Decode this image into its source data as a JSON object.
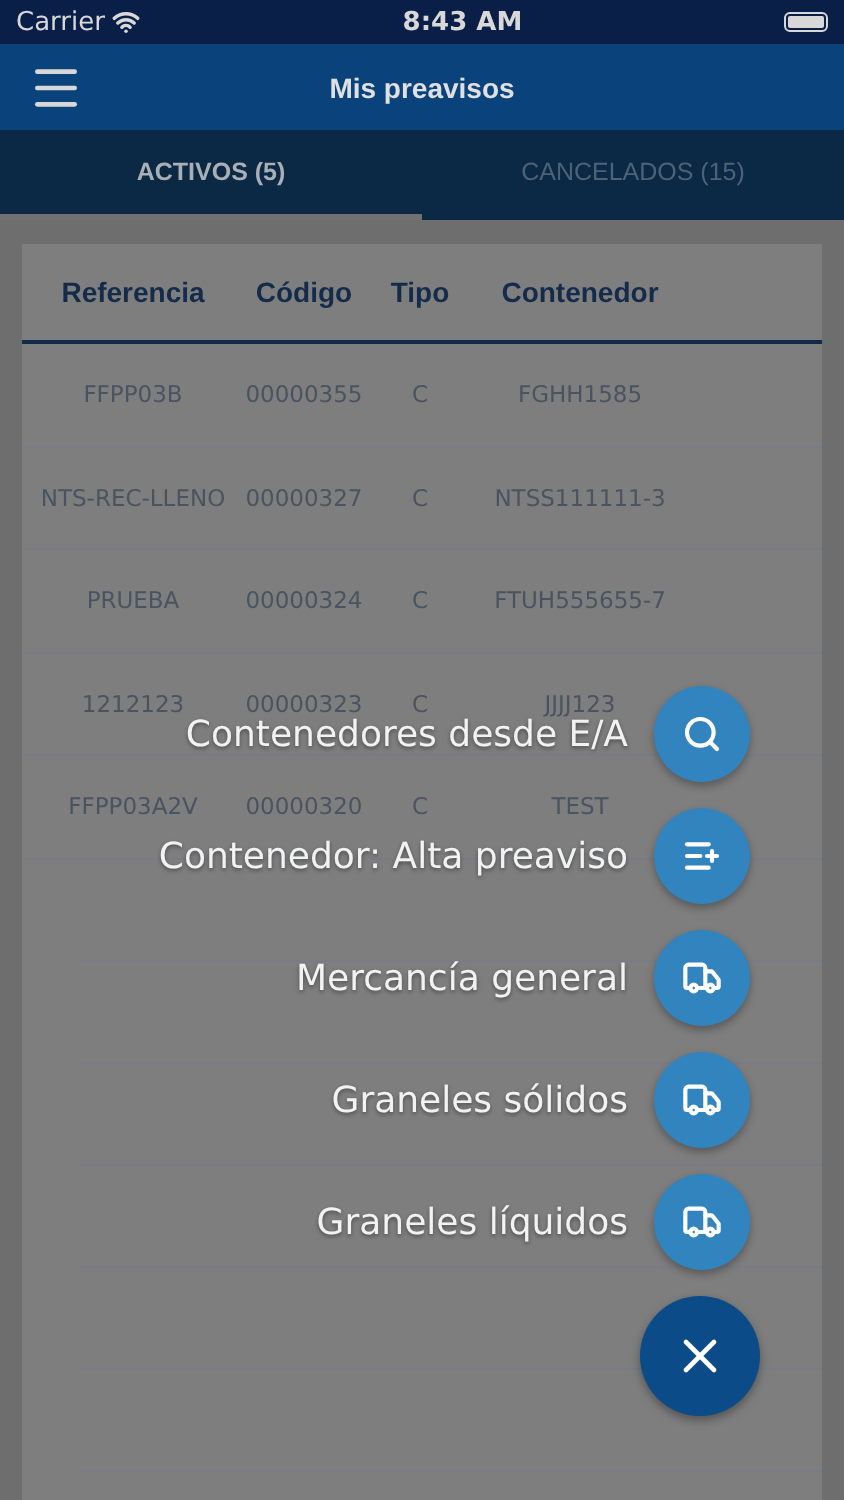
{
  "status_bar": {
    "carrier": "Carrier",
    "time": "8:43 AM"
  },
  "header": {
    "title": "Mis preavisos"
  },
  "tabs": [
    {
      "label": "ACTIVOS (5)",
      "selected": true
    },
    {
      "label": "CANCELADOS (15)",
      "selected": false
    }
  ],
  "table": {
    "columns": [
      "Referencia",
      "Código",
      "Tipo",
      "Contenedor"
    ],
    "rows": [
      [
        "FFPP03B",
        "00000355",
        "C",
        "FGHH1585"
      ],
      [
        "NTS-REC-LLENO",
        "00000327",
        "C",
        "NTSS111111-3"
      ],
      [
        "PRUEBA",
        "00000324",
        "C",
        "FTUH555655-7"
      ],
      [
        "1212123",
        "00000323",
        "C",
        "JJJJ123"
      ],
      [
        "FFPP03A2V",
        "00000320",
        "C",
        "TEST"
      ]
    ]
  },
  "fab_menu": {
    "expanded": true,
    "actions": [
      {
        "label": "Contenedores desde E/A"
      },
      {
        "label": "Contenedor: Alta preaviso"
      },
      {
        "label": "Mercancía general"
      },
      {
        "label": "Graneles sólidos"
      },
      {
        "label": "Graneles líquidos"
      }
    ]
  }
}
